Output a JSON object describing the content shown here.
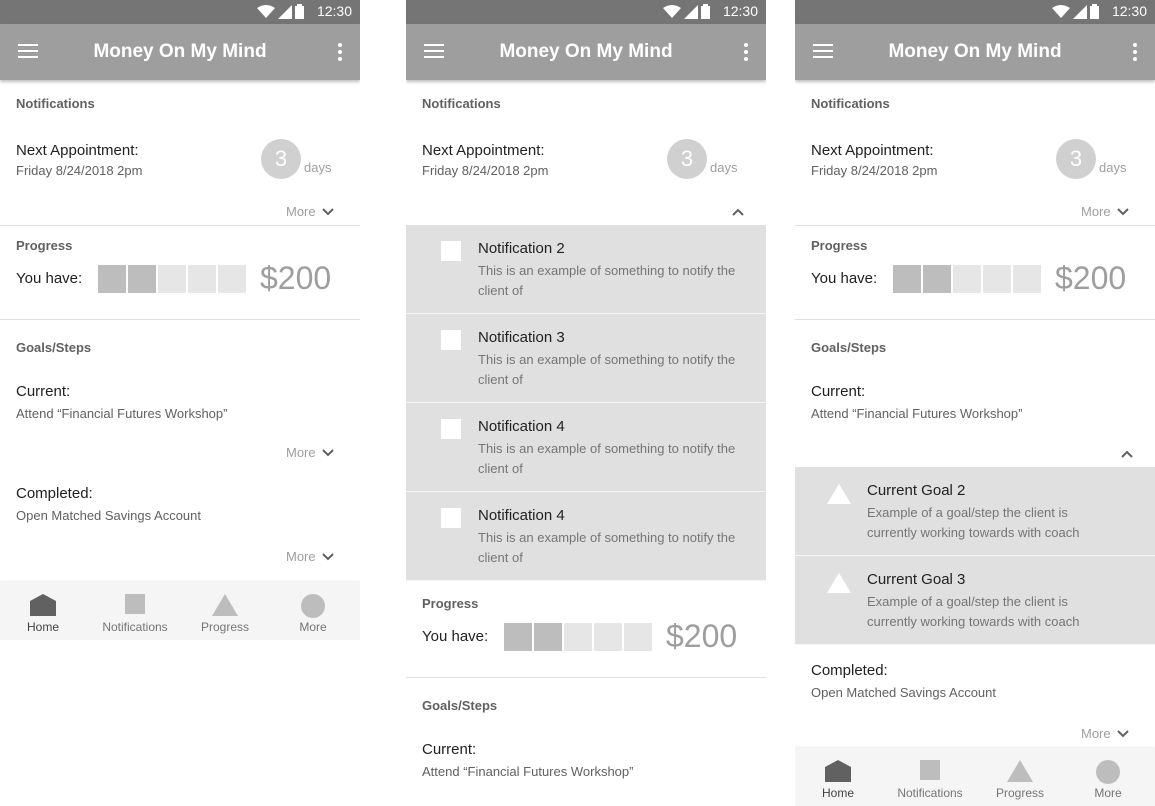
{
  "status": {
    "time": "12:30"
  },
  "app": {
    "title": "Money On My Mind"
  },
  "notifications": {
    "section_title": "Notifications",
    "next_label": "Next Appointment:",
    "next_date": "Friday 8/24/2018 2pm",
    "countdown_value": "3",
    "countdown_unit": "days",
    "more_label": "More",
    "items": [
      {
        "title": "Notification 2",
        "body": "This is an example of something to notify the client of"
      },
      {
        "title": "Notification 3",
        "body": "This is an example of something to notify the client of"
      },
      {
        "title": "Notification 4",
        "body": "This is an example of something to notify the client of"
      },
      {
        "title": "Notification 4",
        "body": "This is an example of something to notify the client of"
      }
    ]
  },
  "progress": {
    "section_title": "Progress",
    "label": "You have:",
    "amount": "$200",
    "filled_segments": 2,
    "total_segments": 5
  },
  "goals": {
    "section_title": "Goals/Steps",
    "current_label": "Current:",
    "current_value": "Attend “Financial Futures Workshop”",
    "completed_label": "Completed:",
    "completed_value": "Open Matched Savings Account",
    "more_label": "More",
    "items": [
      {
        "title": "Current Goal 2",
        "body": "Example of a goal/step the client is currently working towards with coach"
      },
      {
        "title": "Current Goal 3",
        "body": "Example of a goal/step the client is currently working towards with coach"
      }
    ]
  },
  "bottom_nav": {
    "active": "home",
    "items": [
      {
        "label": "Home",
        "icon": "home-icon"
      },
      {
        "label": "Notifications",
        "icon": "square-icon"
      },
      {
        "label": "Progress",
        "icon": "triangle-icon"
      },
      {
        "label": "More",
        "icon": "circle-icon"
      }
    ]
  },
  "colors": {
    "appbar": "#9e9e9e",
    "statusbar": "#757575",
    "expanded_bg": "#e0e0e0"
  }
}
